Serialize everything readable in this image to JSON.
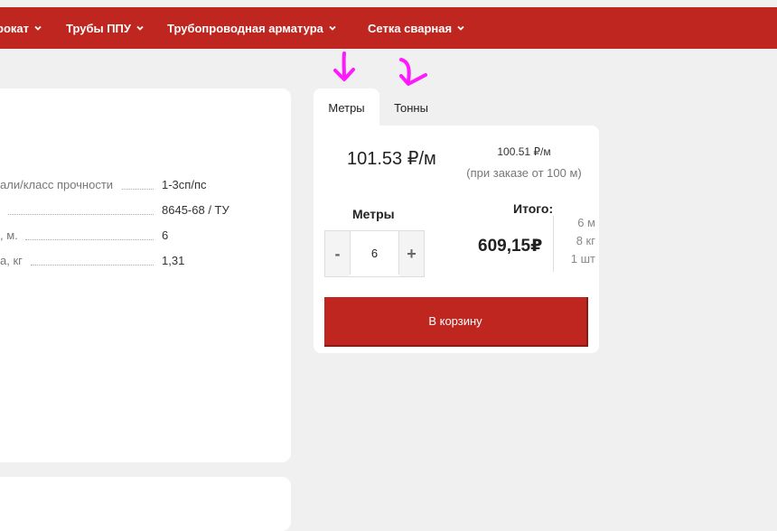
{
  "nav": {
    "items": [
      {
        "label": "рокат"
      },
      {
        "label": "Трубы ППУ"
      },
      {
        "label": "Трубопроводная арматура"
      },
      {
        "label": "Сетка сварная"
      }
    ]
  },
  "specs": {
    "rows": [
      {
        "label": "али/класс прочности",
        "value": "1-3сп/пс"
      },
      {
        "label": "",
        "value": "8645-68 / ТУ"
      },
      {
        "label": ", м.",
        "value": "6"
      },
      {
        "label": "а, кг",
        "value": "1,31"
      }
    ]
  },
  "tabs": {
    "meters": "Метры",
    "tons": "Тонны"
  },
  "price": {
    "main": "101.53 ₽/м",
    "bulk": "100.51 ₽/м",
    "bulk_note": "(при заказе от 100 м)"
  },
  "quantity": {
    "label": "Метры",
    "minus": "-",
    "plus": "+",
    "value": "6"
  },
  "total": {
    "label": "Итого:",
    "value": "609,15₽",
    "units": [
      "6 м",
      "8 кг",
      "1 шт"
    ]
  },
  "cart": {
    "button_label": "В корзину"
  },
  "colors": {
    "brand_red": "#bf2620",
    "annotation_arrow": "#ff19ff"
  },
  "icons": {
    "nav_chevron": "chevron-down-icon",
    "annotation": "arrow-down-icon"
  }
}
